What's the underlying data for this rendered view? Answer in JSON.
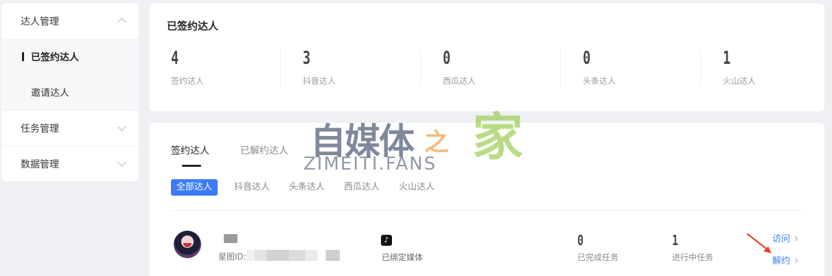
{
  "sidebar": {
    "groups": [
      {
        "label": "达人管理",
        "expanded": true
      },
      {
        "label": "任务管理",
        "expanded": false
      },
      {
        "label": "数据管理",
        "expanded": false
      }
    ],
    "sub_items": [
      {
        "label": "已签约达人",
        "active": true
      },
      {
        "label": "邀请达人",
        "active": false
      }
    ]
  },
  "stats_card": {
    "title": "已签约达人",
    "stats": [
      {
        "value": "4",
        "label": "签约达人"
      },
      {
        "value": "3",
        "label": "抖音达人"
      },
      {
        "value": "0",
        "label": "西瓜达人"
      },
      {
        "value": "0",
        "label": "头条达人"
      },
      {
        "value": "1",
        "label": "火山达人"
      }
    ]
  },
  "list_card": {
    "tabs": [
      {
        "label": "签约达人",
        "active": true
      },
      {
        "label": "已解约达人",
        "active": false
      }
    ],
    "filters": [
      {
        "label": "全部达人",
        "active": true
      },
      {
        "label": "抖音达人",
        "active": false
      },
      {
        "label": "头条达人",
        "active": false
      },
      {
        "label": "西瓜达人",
        "active": false
      },
      {
        "label": "火山达人",
        "active": false
      }
    ],
    "row": {
      "star_id_label": "星图ID:",
      "media_label": "已绑定媒体",
      "completed": {
        "value": "0",
        "label": "已完成任务"
      },
      "in_progress": {
        "value": "1",
        "label": "进行中任务"
      },
      "visit_link": "访问",
      "terminate_link": "解约"
    }
  },
  "watermark": {
    "text_cn": "自媒体",
    "text_zhi": "之",
    "text_jia": "家",
    "text_en": "ZIMEITI.FANS"
  },
  "colors": {
    "accent": "#3d7bf5",
    "background": "#eef0f4",
    "annotation_arrow": "#e8402a"
  },
  "icons": {
    "media_icon": "tiktok-icon",
    "annotation": "red-arrow-icon"
  }
}
